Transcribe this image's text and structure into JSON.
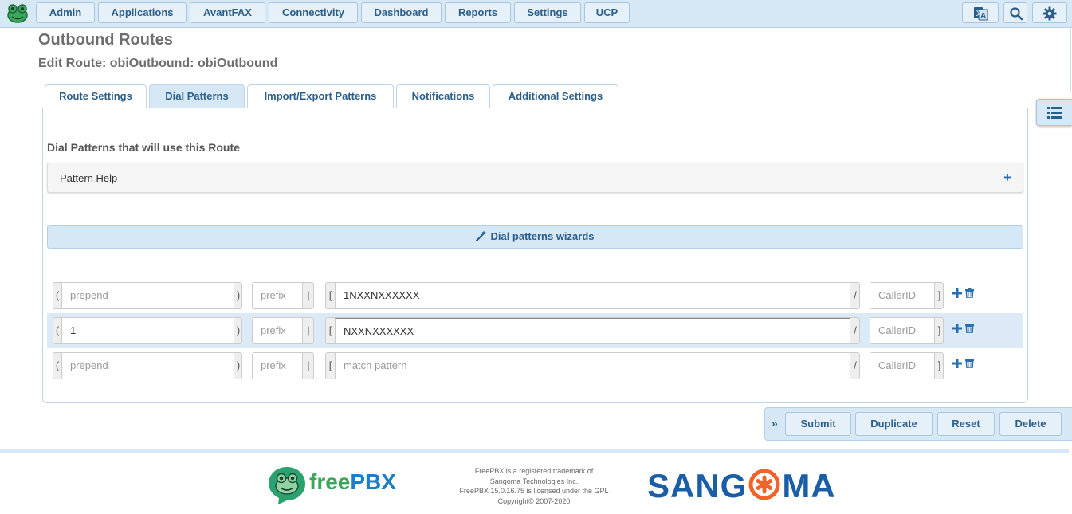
{
  "nav": {
    "items": [
      {
        "label": "Admin"
      },
      {
        "label": "Applications"
      },
      {
        "label": "AvantFAX"
      },
      {
        "label": "Connectivity"
      },
      {
        "label": "Dashboard"
      },
      {
        "label": "Reports"
      },
      {
        "label": "Settings"
      },
      {
        "label": "UCP"
      }
    ],
    "icons": [
      "language-icon",
      "search-icon",
      "gear-icon"
    ]
  },
  "page": {
    "title": "Outbound Routes",
    "subtitle": "Edit Route: obiOutbound: obiOutbound"
  },
  "tabs": [
    {
      "label": "Route Settings",
      "active": false
    },
    {
      "label": "Dial Patterns",
      "active": true
    },
    {
      "label": "Import/Export Patterns",
      "active": false
    },
    {
      "label": "Notifications",
      "active": false
    },
    {
      "label": "Additional Settings",
      "active": false
    }
  ],
  "dial_patterns": {
    "heading": "Dial Patterns that will use this Route",
    "help_title": "Pattern Help",
    "wizard_label": "Dial patterns wizards",
    "placeholders": {
      "prepend": "prepend",
      "prefix": "prefix",
      "match": "match pattern",
      "callerid": "CallerID"
    },
    "rows": [
      {
        "prepend": "",
        "prefix": "",
        "match": "1NXXNXXXXXX",
        "callerid": ""
      },
      {
        "prepend": "1",
        "prefix": "",
        "match": "NXXNXXXXXX",
        "callerid": ""
      },
      {
        "prepend": "",
        "prefix": "",
        "match": "",
        "callerid": ""
      }
    ],
    "brackets": {
      "open_paren": "(",
      "close_paren": ")",
      "pipe": "|",
      "open_bracket": "[",
      "slash": "/",
      "close_bracket": "]"
    }
  },
  "actions": {
    "submit": "Submit",
    "duplicate": "Duplicate",
    "reset": "Reset",
    "delete": "Delete"
  },
  "footer": {
    "legal_lines": [
      "FreePBX is a registered trademark of",
      "Sangoma Technologies Inc.",
      "FreePBX 15.0.16.75 is licensed under the GPL",
      "Copyright© 2007-2020"
    ],
    "freepbx_logo_text_a": "free",
    "freepbx_logo_text_b": "PBX",
    "sangoma_logo_text_a": "SANG",
    "sangoma_logo_text_b": "MA"
  },
  "colors": {
    "nav_bg": "#d6e8f6",
    "accent_blue": "#2a5f8a",
    "freepbx_green": "#3aa65c",
    "sangoma_blue": "#1b5ea8",
    "sangoma_orange": "#f0642c"
  }
}
